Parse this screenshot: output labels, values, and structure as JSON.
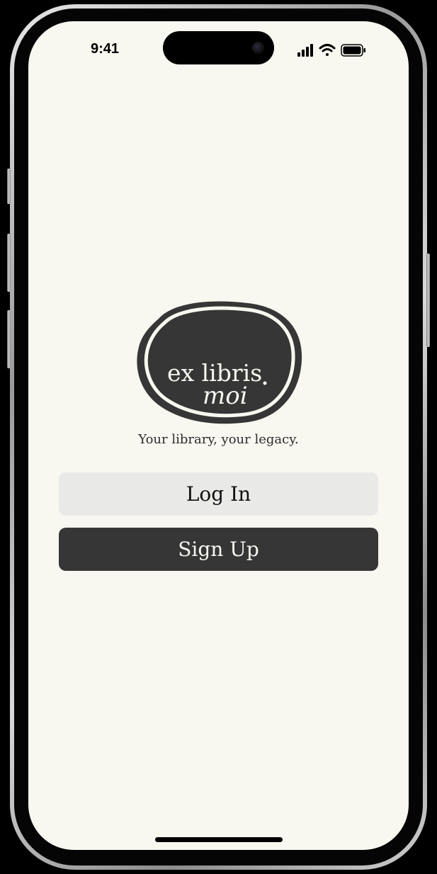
{
  "status_bar": {
    "time": "9:41",
    "icons": [
      "cellular-signal-icon",
      "wifi-icon",
      "battery-icon"
    ]
  },
  "logo": {
    "text_line1": "ex libris",
    "text_line2": "moi",
    "colors": {
      "badge": "#363636",
      "ring": "#f8f7f0",
      "text": "#f8f7f0"
    }
  },
  "tagline": "Your library, your legacy.",
  "buttons": {
    "login_label": "Log In",
    "signup_label": "Sign Up"
  },
  "colors": {
    "background": "#f8f7f0",
    "primary": "#363636",
    "secondary": "#e9e9e8"
  }
}
